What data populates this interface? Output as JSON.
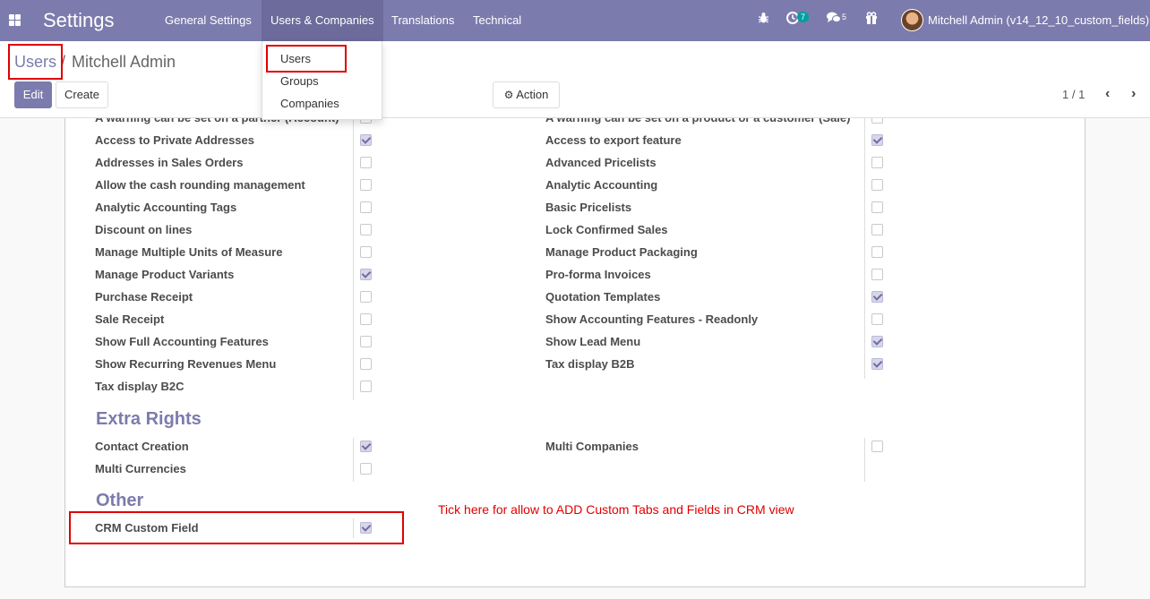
{
  "navbar": {
    "brand": "Settings",
    "menu": [
      "General Settings",
      "Users & Companies",
      "Translations",
      "Technical"
    ],
    "activity_count": "7",
    "message_count": "5",
    "user_name": "Mitchell Admin (v14_12_10_custom_fields)"
  },
  "breadcrumb": {
    "parent": "Users",
    "separator": "/",
    "current": "Mitchell Admin"
  },
  "toolbar": {
    "edit_label": "Edit",
    "create_label": "Create",
    "action_label": "Action",
    "pager": "1 / 1"
  },
  "dropdown": {
    "items": [
      "Users",
      "Groups",
      "Companies"
    ]
  },
  "technical_settings": {
    "cut_left": "A warning can be set on a partner (Account)",
    "cut_right": "A warning can be set on a product or a customer (Sale)",
    "left": [
      {
        "label": "Access to Private Addresses",
        "checked": true
      },
      {
        "label": "Addresses in Sales Orders",
        "checked": false
      },
      {
        "label": "Allow the cash rounding management",
        "checked": false
      },
      {
        "label": "Analytic Accounting Tags",
        "checked": false
      },
      {
        "label": "Discount on lines",
        "checked": false
      },
      {
        "label": "Manage Multiple Units of Measure",
        "checked": false
      },
      {
        "label": "Manage Product Variants",
        "checked": true
      },
      {
        "label": "Purchase Receipt",
        "checked": false
      },
      {
        "label": "Sale Receipt",
        "checked": false
      },
      {
        "label": "Show Full Accounting Features",
        "checked": false
      },
      {
        "label": "Show Recurring Revenues Menu",
        "checked": false
      },
      {
        "label": "Tax display B2C",
        "checked": false
      }
    ],
    "right": [
      {
        "label": "Access to export feature",
        "checked": true
      },
      {
        "label": "Advanced Pricelists",
        "checked": false
      },
      {
        "label": "Analytic Accounting",
        "checked": false
      },
      {
        "label": "Basic Pricelists",
        "checked": false
      },
      {
        "label": "Lock Confirmed Sales",
        "checked": false
      },
      {
        "label": "Manage Product Packaging",
        "checked": false
      },
      {
        "label": "Pro-forma Invoices",
        "checked": false
      },
      {
        "label": "Quotation Templates",
        "checked": true
      },
      {
        "label": "Show Accounting Features - Readonly",
        "checked": false
      },
      {
        "label": "Show Lead Menu",
        "checked": true
      },
      {
        "label": "Tax display B2B",
        "checked": true
      }
    ]
  },
  "extra_rights": {
    "title": "Extra Rights",
    "contact_creation": {
      "label": "Contact Creation",
      "checked": true
    },
    "multi_currencies": {
      "label": "Multi Currencies",
      "checked": false
    },
    "multi_companies": {
      "label": "Multi Companies",
      "checked": false
    }
  },
  "other": {
    "title": "Other",
    "crm_custom_field": {
      "label": "CRM Custom Field",
      "checked": true
    }
  },
  "annotation_note": "Tick here for allow to ADD Custom Tabs and Fields in CRM view",
  "colors": {
    "brand": "#7c7bad",
    "highlight": "#e00000"
  }
}
